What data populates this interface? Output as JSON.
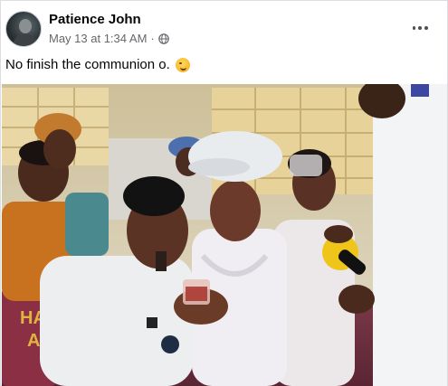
{
  "post": {
    "author": "Patience John",
    "date": "May 13 at 1:34 AM",
    "separator": "·",
    "audience_icon": "globe-icon",
    "text": "No finish the communion o.",
    "emoji_icon": "winking-tongue-emoji-icon",
    "more_icon": "more-options-icon"
  },
  "photo": {
    "description_icon": "photo-image",
    "banner_text": "HA A"
  },
  "colors": {
    "name": "#050505",
    "meta": "#65676b",
    "border": "#dadde1"
  }
}
